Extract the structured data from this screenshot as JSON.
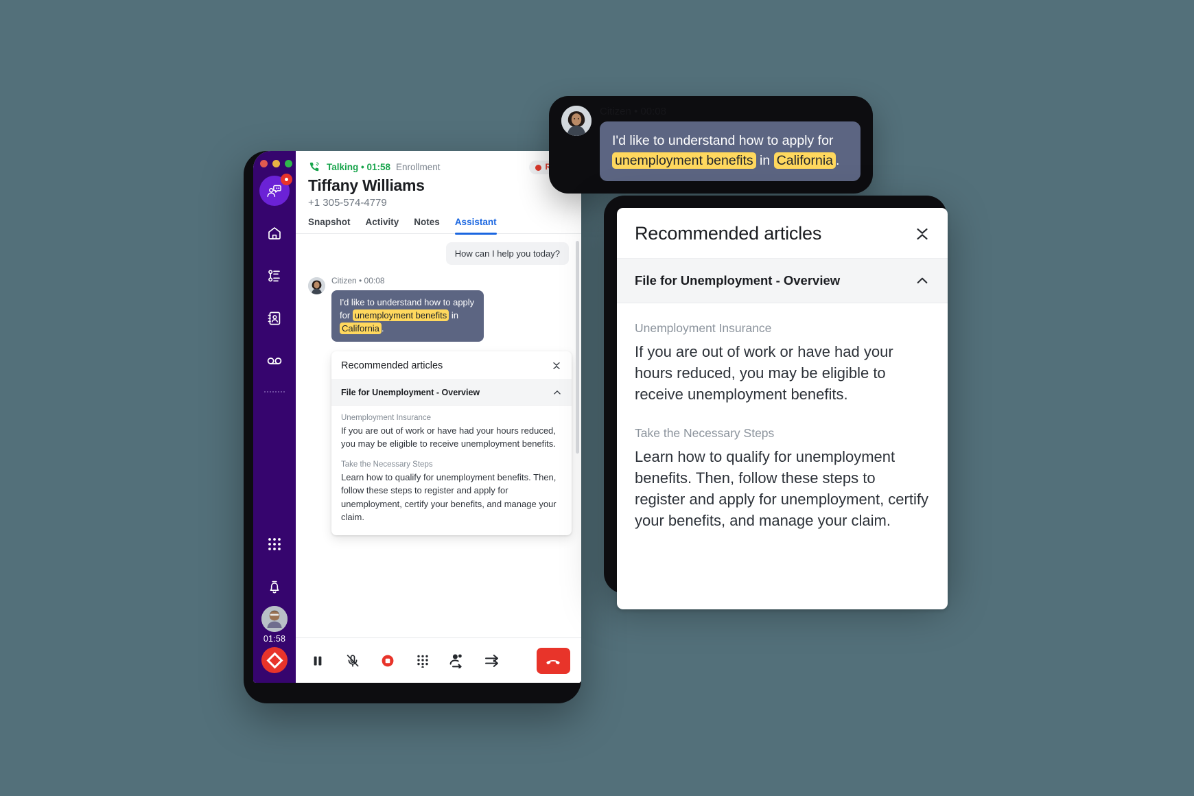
{
  "app": {
    "window_controls": [
      "close",
      "minimize",
      "maximize"
    ]
  },
  "sidebar": {
    "items": [
      {
        "name": "agent-assist",
        "icon": "agent-assist-icon",
        "badge": true
      },
      {
        "name": "home",
        "icon": "home-icon"
      },
      {
        "name": "queues",
        "icon": "queue-list-icon"
      },
      {
        "name": "contacts",
        "icon": "contacts-book-icon"
      },
      {
        "name": "voicemail",
        "icon": "voicemail-icon"
      }
    ],
    "bottom_items": [
      {
        "name": "apps",
        "icon": "apps-grid-icon"
      },
      {
        "name": "notifications",
        "icon": "bell-icon"
      }
    ],
    "agent": {
      "timer": "01:58",
      "status": "busy",
      "status_icon": "diamond-busy-icon"
    }
  },
  "call_header": {
    "phone_icon": "phone-ringing-icon",
    "status": "Talking • 01:58",
    "queue": "Enrollment",
    "recording_badge": "REC",
    "customer_name": "Tiffany Williams",
    "customer_phone": "+1 305-574-4779"
  },
  "tabs": [
    {
      "label": "Snapshot",
      "active": false
    },
    {
      "label": "Activity",
      "active": false
    },
    {
      "label": "Notes",
      "active": false
    },
    {
      "label": "Assistant",
      "active": true
    }
  ],
  "conversation": {
    "bot_greeting": "How can I help you today?",
    "citizen_meta": "Citizen • 00:08",
    "citizen_message": {
      "pre": "I'd like to understand how to apply for ",
      "highlight_1": "unemployment benefits",
      "mid": " in ",
      "highlight_2": "California",
      "post": "."
    }
  },
  "recommended": {
    "panel_title": "Recommended articles",
    "collapse_icon": "collapse-chevrons-icon",
    "article": {
      "title": "File for Unemployment - Overview",
      "expand_icon": "chevron-up-icon",
      "sections": [
        {
          "subtitle": "Unemployment Insurance",
          "body": "If you are out of work or have had your hours reduced, you may be eligible to receive unemployment benefits."
        },
        {
          "subtitle": "Take the Necessary Steps",
          "body": "Learn how to qualify for unemployment benefits. Then, follow these steps to register and apply for unemployment, certify your benefits, and manage your claim."
        }
      ]
    }
  },
  "call_controls": [
    {
      "name": "hold",
      "icon": "pause-icon"
    },
    {
      "name": "mute",
      "icon": "mic-muted-icon"
    },
    {
      "name": "stop-recording",
      "icon": "stop-record-icon"
    },
    {
      "name": "dialpad",
      "icon": "dialpad-icon"
    },
    {
      "name": "add-participant",
      "icon": "add-person-icon"
    },
    {
      "name": "transfer",
      "icon": "transfer-arrows-icon"
    },
    {
      "name": "end-call",
      "icon": "phone-hangup-icon"
    }
  ],
  "colors": {
    "rail_purple": "#36056e",
    "accent_blue": "#1a66e0",
    "talking_green": "#17a44b",
    "record_red": "#e8342a",
    "bubble_slate": "#5c6582",
    "highlight_yellow": "#ffd85e",
    "page_bg": "#53707a"
  }
}
